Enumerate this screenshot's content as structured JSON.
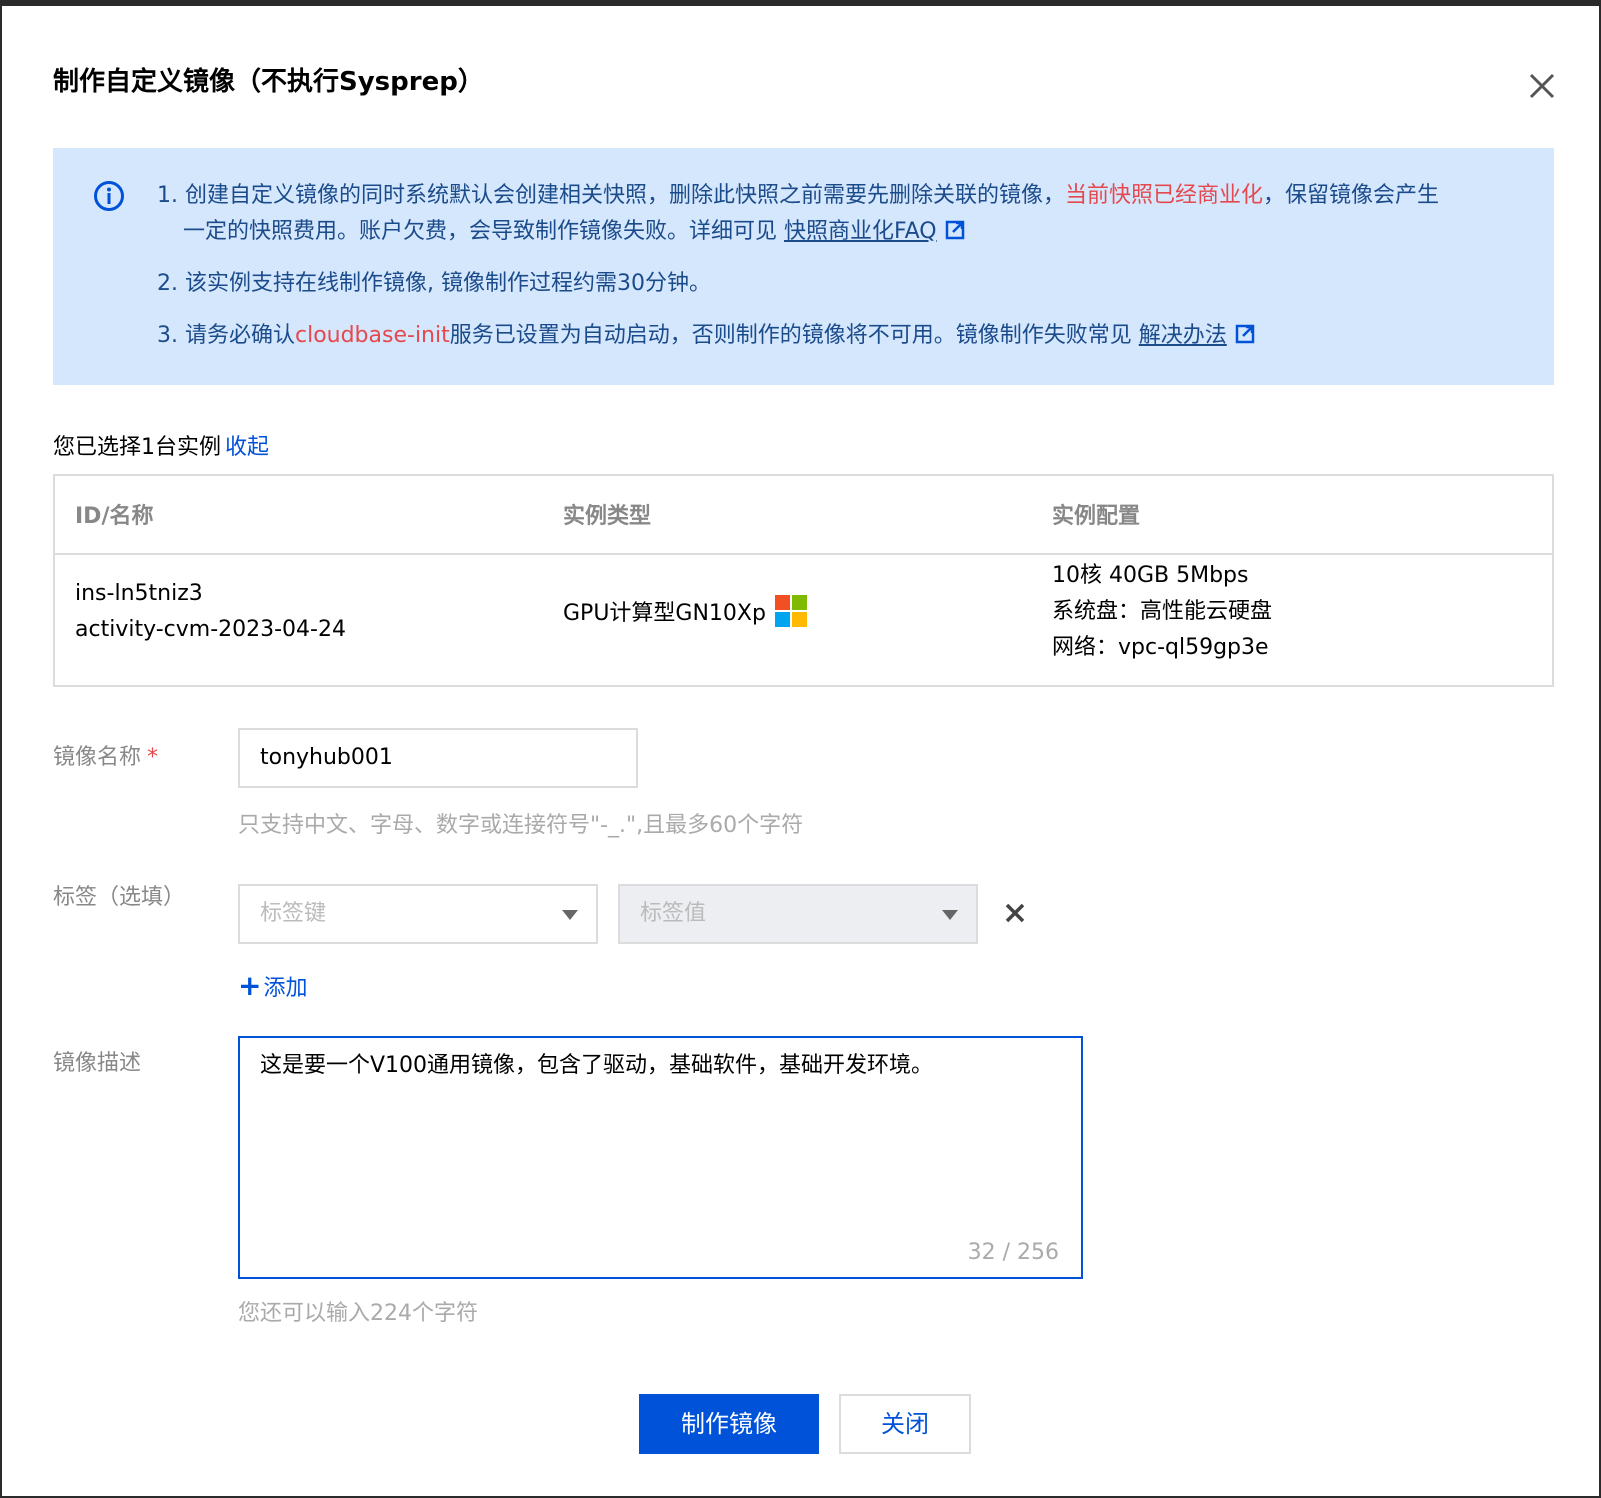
{
  "dialog": {
    "title": "制作自定义镜像（不执行Sysprep）"
  },
  "notice": {
    "item1_pre": "1. 创建自定义镜像的同时系统默认会创建相关快照，删除此快照之前需要先删除关联的镜像，",
    "item1_red": "当前快照已经商业化",
    "item1_post": "，保留镜像会产生一定的快照费用。账户欠费，会导致制作镜像失败。详细可见 ",
    "item1_link": "快照商业化FAQ",
    "item2": "2. 该实例支持在线制作镜像, 镜像制作过程约需30分钟。",
    "item3_pre": "3. 请务必确认",
    "item3_red": "cloudbase-init",
    "item3_post": "服务已设置为自动启动，否则制作的镜像将不可用。镜像制作失败常见 ",
    "item3_link": "解决办法"
  },
  "selection": {
    "text": "您已选择1台实例",
    "collapse": "收起"
  },
  "table": {
    "headers": [
      "ID/名称",
      "实例类型",
      "实例配置"
    ],
    "row": {
      "id": "ins-ln5tniz3",
      "name": "activity-cvm-2023-04-24",
      "type": "GPU计算型GN10Xp",
      "config": [
        "10核 40GB 5Mbps",
        "系统盘：高性能云硬盘",
        "网络：vpc-ql59gp3e"
      ]
    }
  },
  "form": {
    "name_label": "镜像名称",
    "required_mark": "*",
    "name_value": "tonyhub001",
    "name_hint": "只支持中文、字母、数字或连接符号\"-_.\",且最多60个字符",
    "tag_label": "标签（选填）",
    "tag_key_placeholder": "标签键",
    "tag_value_placeholder": "标签值",
    "add_label": "添加",
    "desc_label": "镜像描述",
    "desc_value": "这是要一个V100通用镜像，包含了驱动，基础软件，基础开发环境。",
    "desc_counter": "32 / 256",
    "desc_hint": "您还可以输入224个字符"
  },
  "buttons": {
    "create": "制作镜像",
    "close": "关闭"
  }
}
